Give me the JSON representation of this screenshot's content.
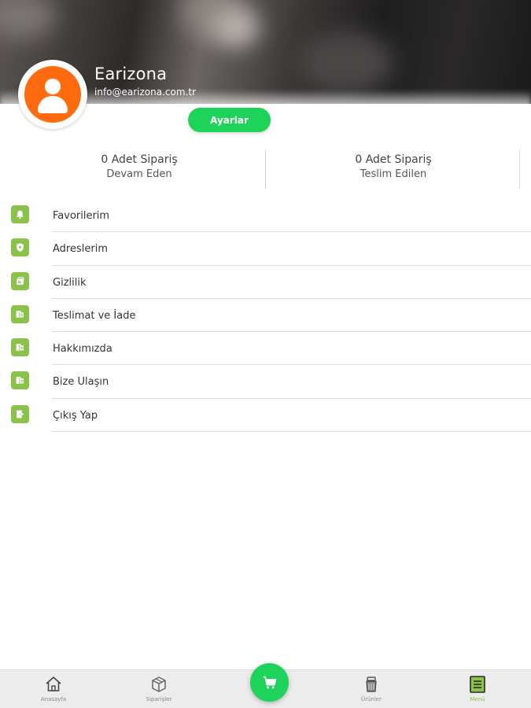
{
  "profile": {
    "name": "Earizona",
    "email": "info@earizona.com.tr",
    "settings_label": "Ayarlar",
    "avatar_color": "#ff6b0f"
  },
  "stats": [
    {
      "count": "0 Adet Sipariş",
      "label": "Devam Eden"
    },
    {
      "count": "0 Adet Sipariş",
      "label": "Teslim Edilen"
    }
  ],
  "menu": {
    "icon_color": "#8bc34a",
    "items": [
      {
        "label": "Favorilerim",
        "icon": "bell-icon"
      },
      {
        "label": "Adreslerim",
        "icon": "shield-icon"
      },
      {
        "label": "Gizlilik",
        "icon": "privacy-icon"
      },
      {
        "label": "Teslimat ve İade",
        "icon": "document-icon"
      },
      {
        "label": "Hakkımızda",
        "icon": "document-icon"
      },
      {
        "label": "Bize Ulaşın",
        "icon": "document-icon"
      },
      {
        "label": "Çıkış Yap",
        "icon": "logout-icon"
      }
    ]
  },
  "bottom_nav": {
    "accent_color": "#1ed35a",
    "active_color": "#8bc34a",
    "items": [
      {
        "label": "Anasayfa",
        "icon": "home-icon",
        "active": false
      },
      {
        "label": "Siparişler",
        "icon": "box-icon",
        "active": false
      },
      {
        "label": "Ürünler",
        "icon": "products-icon",
        "active": false
      },
      {
        "label": "Menü",
        "icon": "menu-icon",
        "active": true
      }
    ],
    "cart_icon": "cart-icon"
  }
}
